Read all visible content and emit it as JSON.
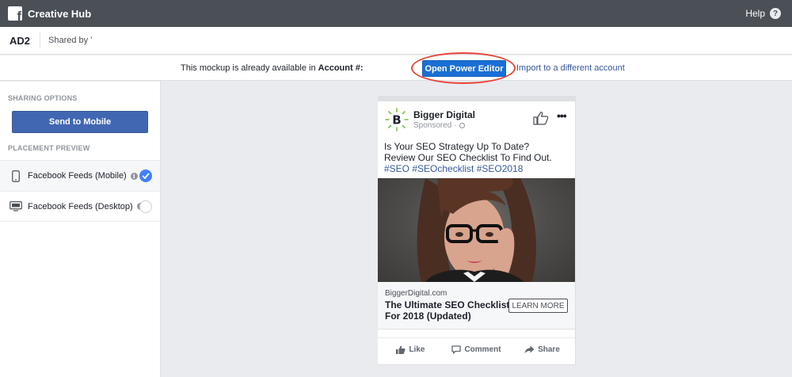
{
  "app": {
    "logo_letter": "f",
    "title": "Creative Hub",
    "help_label": "Help",
    "help_icon": "?"
  },
  "subheader": {
    "ad_name": "AD2",
    "shared_by": "Shared by '"
  },
  "notice": {
    "text_prefix": "This mockup is already available in ",
    "text_bold": "Account #:",
    "open_power_editor": "Open Power Editor",
    "import_link": "Import to a different account"
  },
  "sidebar": {
    "sharing_options_heading": "SHARING OPTIONS",
    "send_to_mobile": "Send to Mobile",
    "placement_preview_heading": "PLACEMENT PREVIEW",
    "placements": [
      {
        "label": "Facebook Feeds (Mobile)",
        "selected": true
      },
      {
        "label": "Facebook Feeds (Desktop)",
        "selected": false
      }
    ],
    "info_glyph": "i"
  },
  "ad_preview": {
    "page_logo_letter": "B",
    "page_name": "Bigger Digital",
    "sponsored_label": "Sponsored · ",
    "more_glyph": "•••",
    "body_line1": "Is Your SEO Strategy Up To Date?",
    "body_line2": "Review Our SEO Checklist To Find Out.",
    "hashtags": "#SEO #SEOchecklist #SEO2018",
    "domain": "BiggerDigital.com",
    "headline_line1": "The Ultimate SEO Checklist",
    "headline_line2": "For 2018 (Updated)",
    "cta": "LEARN MORE",
    "actions": {
      "like": "Like",
      "comment": "Comment",
      "share": "Share"
    }
  },
  "colors": {
    "topbar": "#4b4f56",
    "primary_button": "#1a6fd4",
    "send_button": "#4267b2",
    "highlight": "#e8463a",
    "link": "#365899",
    "logo_accent": "#7ac142"
  }
}
